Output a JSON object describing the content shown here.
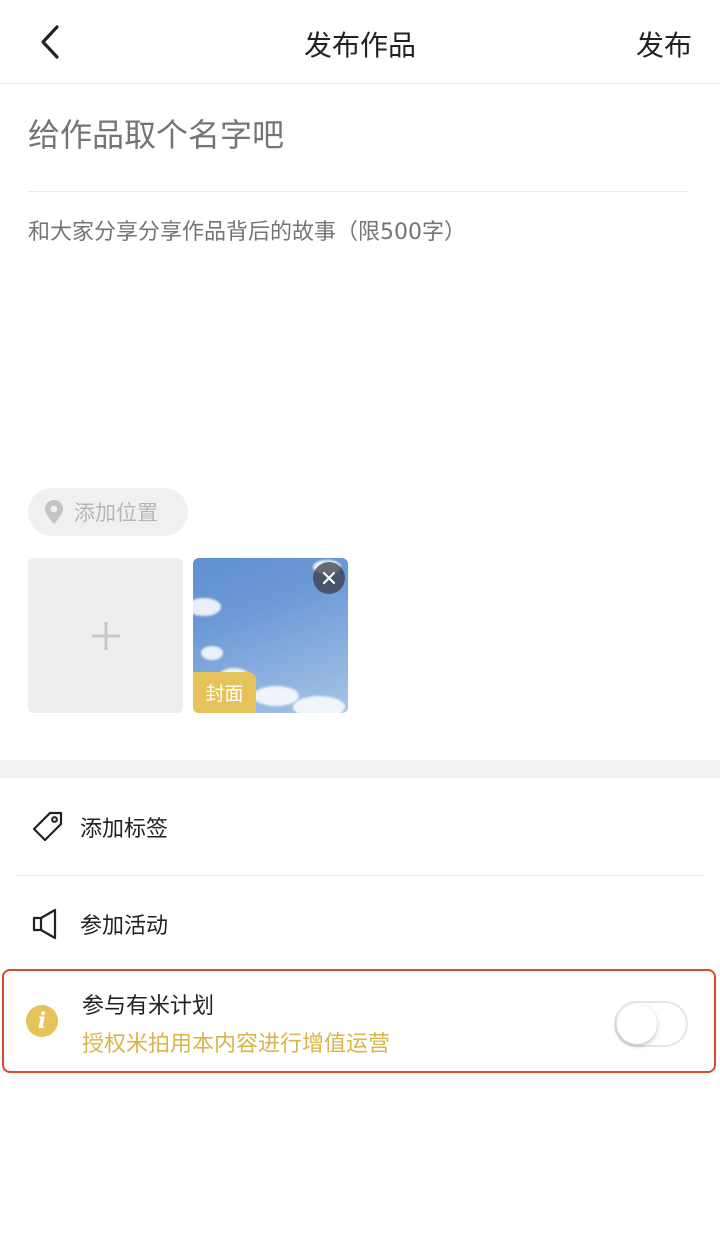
{
  "nav": {
    "title": "发布作品",
    "publish_label": "发布"
  },
  "form": {
    "title_placeholder": "给作品取个名字吧",
    "story_placeholder": "和大家分享分享作品背后的故事（限500字）"
  },
  "location": {
    "label": "添加位置"
  },
  "media": {
    "cover_label": "封面"
  },
  "options": {
    "add_tags_label": "添加标签",
    "join_activity_label": "参加活动"
  },
  "plan": {
    "title": "参与有米计划",
    "subtitle": "授权米拍用本内容进行增值运营",
    "enabled": false
  },
  "colors": {
    "accent_yellow": "#e6c25a",
    "highlight_border": "#d64a2e"
  }
}
